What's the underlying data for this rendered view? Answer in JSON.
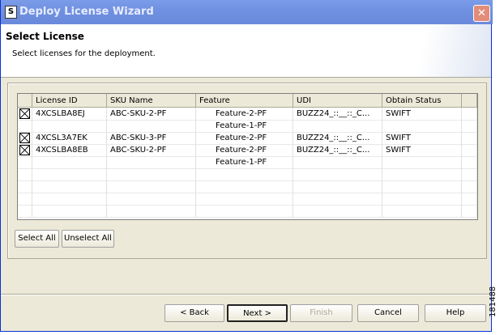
{
  "window": {
    "title": "Deploy License Wizard",
    "close": "✕",
    "icon": "S"
  },
  "header": {
    "title": "Select License",
    "subtitle": "Select licenses for the deployment."
  },
  "table": {
    "columns": [
      "",
      "License ID",
      "SKU Name",
      "Feature",
      "UDI",
      "Obtain Status",
      ""
    ],
    "rows": [
      {
        "checked": true,
        "license_id": "4XCSLBA8EJ",
        "sku": "ABC-SKU-2-PF",
        "feature": "Feature-2-PF",
        "udi": "BUZZ24_::__::_C...",
        "status": "SWIFT"
      },
      {
        "checked": false,
        "license_id": "",
        "sku": "",
        "feature": "Feature-1-PF",
        "udi": "",
        "status": ""
      },
      {
        "checked": true,
        "license_id": "4XCSL3A7EK",
        "sku": "ABC-SKU-3-PF",
        "feature": "Feature-2-PF",
        "udi": "BUZZ24_::__::_C...",
        "status": "SWIFT"
      },
      {
        "checked": true,
        "license_id": "4XCSLBA8EB",
        "sku": "ABC-SKU-2-PF",
        "feature": "Feature-2-PF",
        "udi": "BUZZ24_::__::_C...",
        "status": "SWIFT"
      },
      {
        "checked": false,
        "license_id": "",
        "sku": "",
        "feature": "Feature-1-PF",
        "udi": "",
        "status": ""
      }
    ]
  },
  "buttons": {
    "select_all": "Select All",
    "unselect_all": "Unselect All",
    "back": "< Back",
    "next": "Next >",
    "finish": "Finish",
    "cancel": "Cancel",
    "help": "Help"
  },
  "side_label": "181488"
}
